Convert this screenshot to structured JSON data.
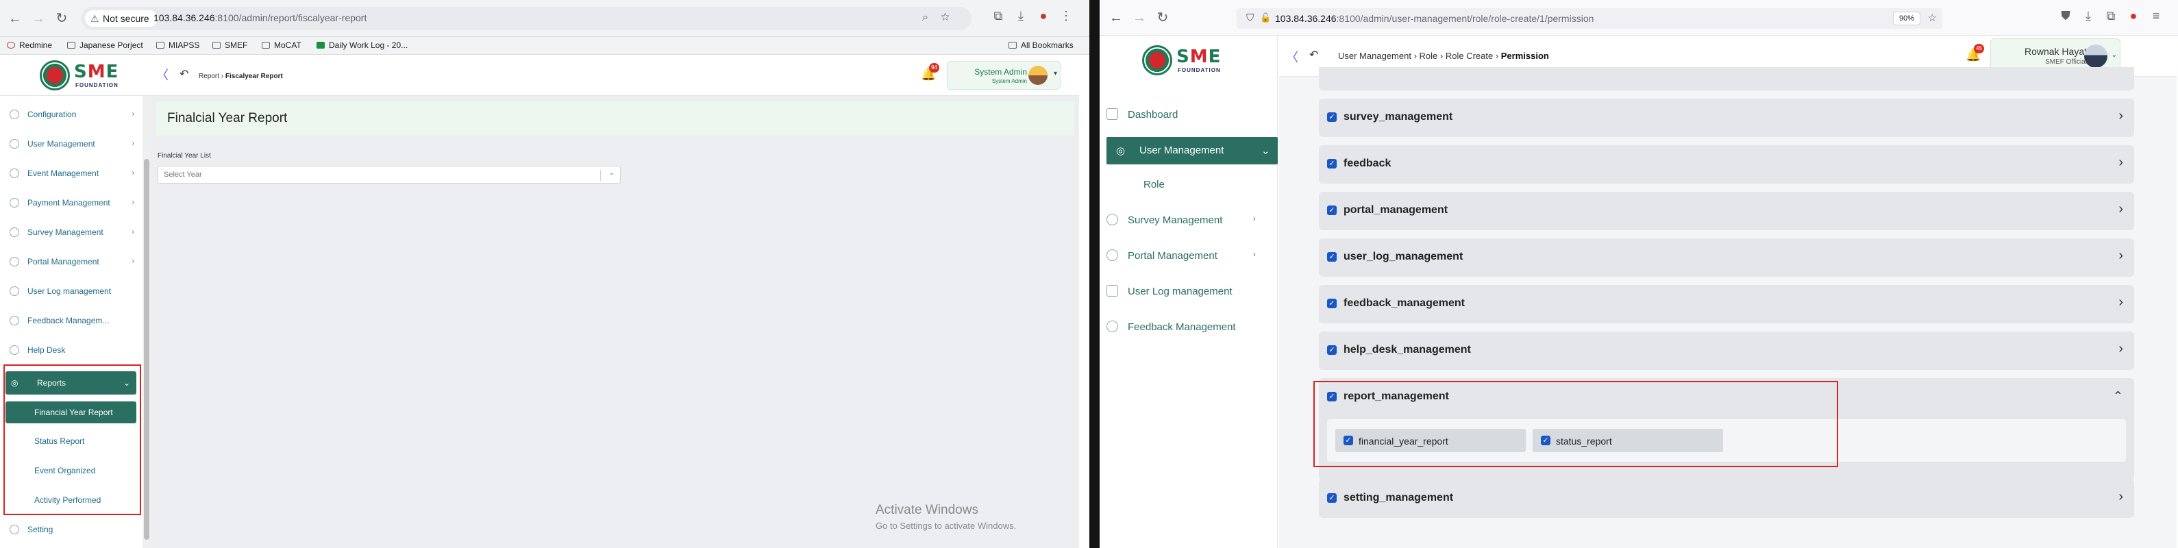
{
  "left": {
    "browser": {
      "security": "Not secure",
      "url_host": "103.84.36.246",
      "url_path": ":8100/admin/report/fiscalyear-report",
      "bookmarks": [
        "Redmine",
        "Japanese Porject",
        "MIAPSS",
        "SMEF",
        "MoCAT",
        "Daily Work Log - 20...",
        "All Bookmarks"
      ]
    },
    "app": {
      "logo_text": "SME",
      "logo_sub": "FOUNDATION",
      "breadcrumb_parent": "Report",
      "breadcrumb_current": "Fiscalyear Report",
      "notification_count": "94",
      "user_name": "System Admin",
      "user_role": "System Admin"
    },
    "sidebar": {
      "items": [
        {
          "label": "Configuration",
          "has_arrow": true
        },
        {
          "label": "User Management",
          "has_arrow": true
        },
        {
          "label": "Event Management",
          "has_arrow": true
        },
        {
          "label": "Payment Management",
          "has_arrow": true
        },
        {
          "label": "Survey Management",
          "has_arrow": true
        },
        {
          "label": "Portal Management",
          "has_arrow": true
        },
        {
          "label": "User Log management",
          "has_arrow": false
        },
        {
          "label": "Feedback Managem...",
          "has_arrow": false
        },
        {
          "label": "Help Desk",
          "has_arrow": false
        }
      ],
      "active_label": "Reports",
      "submenu": [
        "Financial Year Report",
        "Status Report",
        "Event Organized",
        "Activity Performed"
      ],
      "setting_label": "Setting"
    },
    "main": {
      "title": "Finalcial Year Report",
      "field_label": "Finalcial Year List",
      "select_placeholder": "Select Year"
    },
    "watermark": {
      "line1": "Activate Windows",
      "line2": "Go to Settings to activate Windows."
    }
  },
  "right": {
    "browser": {
      "url_host": "103.84.36.246",
      "url_path": ":8100/admin/user-management/role/role-create/1/permission",
      "zoom": "90%"
    },
    "app": {
      "logo_text": "SME",
      "logo_sub": "FOUNDATION",
      "breadcrumb": [
        "User Management",
        "Role",
        "Role Create",
        "Permission"
      ],
      "notification_count": "45",
      "user_name": "Rownak Hayat",
      "user_role": "SMEF Official"
    },
    "sidebar": {
      "items": [
        {
          "label": "Dashboard",
          "has_arrow": false
        },
        {
          "label": "User Management",
          "has_arrow": true
        },
        {
          "label": "Role",
          "has_arrow": false
        },
        {
          "label": "Survey Management",
          "has_arrow": true
        },
        {
          "label": "Portal Management",
          "has_arrow": true
        },
        {
          "label": "User Log management",
          "has_arrow": false
        },
        {
          "label": "Feedback Management",
          "has_arrow": false
        }
      ],
      "active_label": "User Management"
    },
    "permissions": [
      {
        "label": "survey_management",
        "checked": true,
        "expanded": false
      },
      {
        "label": "feedback",
        "checked": true,
        "expanded": false
      },
      {
        "label": "portal_management",
        "checked": true,
        "expanded": false
      },
      {
        "label": "user_log_management",
        "checked": true,
        "expanded": false
      },
      {
        "label": "feedback_management",
        "checked": true,
        "expanded": false
      },
      {
        "label": "help_desk_management",
        "checked": true,
        "expanded": false
      },
      {
        "label": "report_management",
        "checked": true,
        "expanded": true,
        "children": [
          {
            "label": "financial_year_report",
            "checked": true
          },
          {
            "label": "status_report",
            "checked": true
          }
        ]
      },
      {
        "label": "setting_management",
        "checked": true,
        "expanded": false
      }
    ]
  }
}
